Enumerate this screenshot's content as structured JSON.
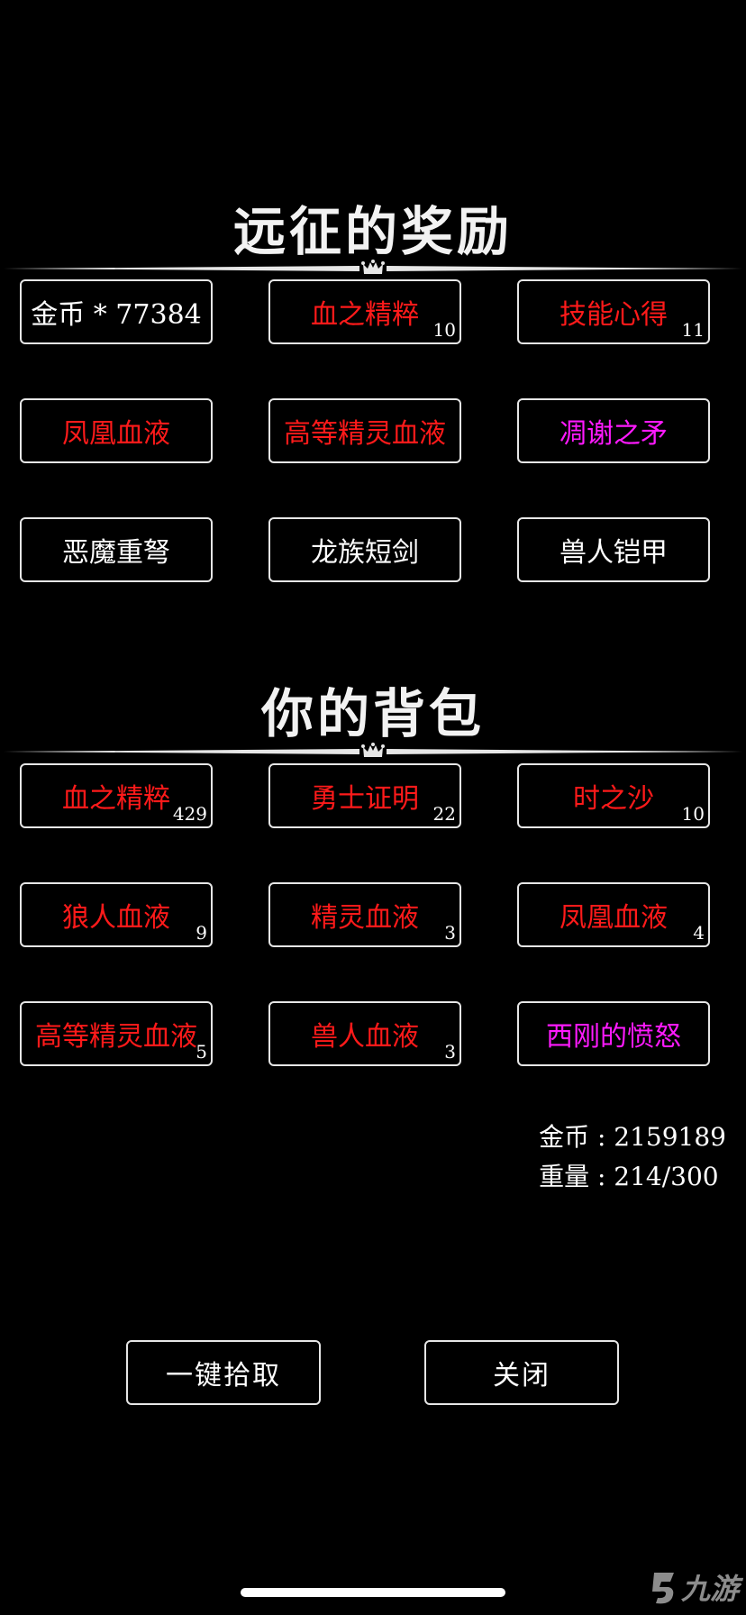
{
  "colors": {
    "background": "#000000",
    "white_item": "#ffffff",
    "red_item": "#ff1a1a",
    "magenta_item": "#ff1aff",
    "border": "#e6e6e6"
  },
  "rewards": {
    "title": "远征的奖励",
    "items": [
      {
        "name": "金币 * 77384",
        "count": "",
        "color": "#ffffff"
      },
      {
        "name": "血之精粹",
        "count": "10",
        "color": "#ff1a1a"
      },
      {
        "name": "技能心得",
        "count": "11",
        "color": "#ff1a1a"
      },
      {
        "name": "凤凰血液",
        "count": "",
        "color": "#ff1a1a"
      },
      {
        "name": "高等精灵血液",
        "count": "",
        "color": "#ff1a1a"
      },
      {
        "name": "凋谢之矛",
        "count": "",
        "color": "#ff1aff"
      },
      {
        "name": "恶魔重弩",
        "count": "",
        "color": "#ffffff"
      },
      {
        "name": "龙族短剑",
        "count": "",
        "color": "#ffffff"
      },
      {
        "name": "兽人铠甲",
        "count": "",
        "color": "#ffffff"
      }
    ]
  },
  "backpack": {
    "title": "你的背包",
    "items": [
      {
        "name": "血之精粹",
        "count": "429",
        "color": "#ff1a1a"
      },
      {
        "name": "勇士证明",
        "count": "22",
        "color": "#ff1a1a"
      },
      {
        "name": "时之沙",
        "count": "10",
        "color": "#ff1a1a"
      },
      {
        "name": "狼人血液",
        "count": "9",
        "color": "#ff1a1a"
      },
      {
        "name": "精灵血液",
        "count": "3",
        "color": "#ff1a1a"
      },
      {
        "name": "凤凰血液",
        "count": "4",
        "color": "#ff1a1a"
      },
      {
        "name": "高等精灵血液",
        "count": "5",
        "color": "#ff1a1a"
      },
      {
        "name": "兽人血液",
        "count": "3",
        "color": "#ff1a1a"
      },
      {
        "name": "西刚的愤怒",
        "count": "",
        "color": "#ff1aff"
      }
    ]
  },
  "stats": {
    "gold": "金币 : 2159189",
    "weight": "重量 : 214/300"
  },
  "buttons": {
    "pickup_all": "一键拾取",
    "close": "关闭"
  },
  "watermark": {
    "text": "九游",
    "icon": "nine-game-logo-icon"
  }
}
